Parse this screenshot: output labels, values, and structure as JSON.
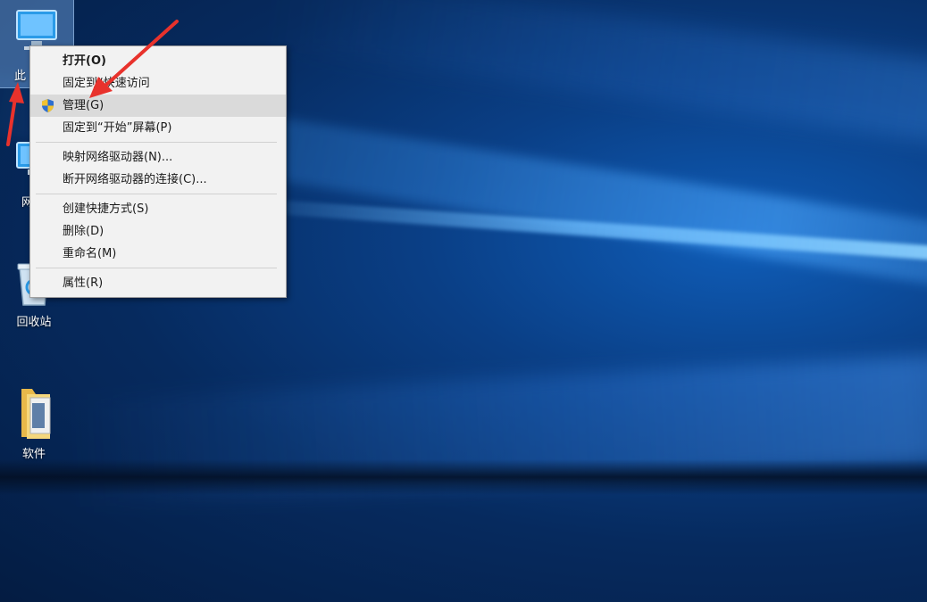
{
  "desktop": {
    "icons": [
      {
        "label": "此",
        "icon": "this-pc-icon"
      },
      {
        "label": "网",
        "icon": "network-icon"
      },
      {
        "label": "回收站",
        "icon": "recycle-bin-icon"
      },
      {
        "label": "软件",
        "icon": "folder-icon"
      }
    ]
  },
  "context_menu": {
    "items": [
      {
        "label": "打开(O)"
      },
      {
        "label": "固定到“快速访问"
      },
      {
        "label": "管理(G)",
        "icon": "uac-shield-icon"
      },
      {
        "label": "固定到“开始”屏幕(P)"
      },
      {
        "label": "映射网络驱动器(N)..."
      },
      {
        "label": "断开网络驱动器的连接(C)..."
      },
      {
        "label": "创建快捷方式(S)"
      },
      {
        "label": "删除(D)"
      },
      {
        "label": "重命名(M)"
      },
      {
        "label": "属性(R)"
      }
    ]
  },
  "colors": {
    "menu_bg": "#f2f2f2",
    "menu_hover": "#dadada",
    "arrow": "#e8322c",
    "desktop_blue": "#0a3f86"
  }
}
